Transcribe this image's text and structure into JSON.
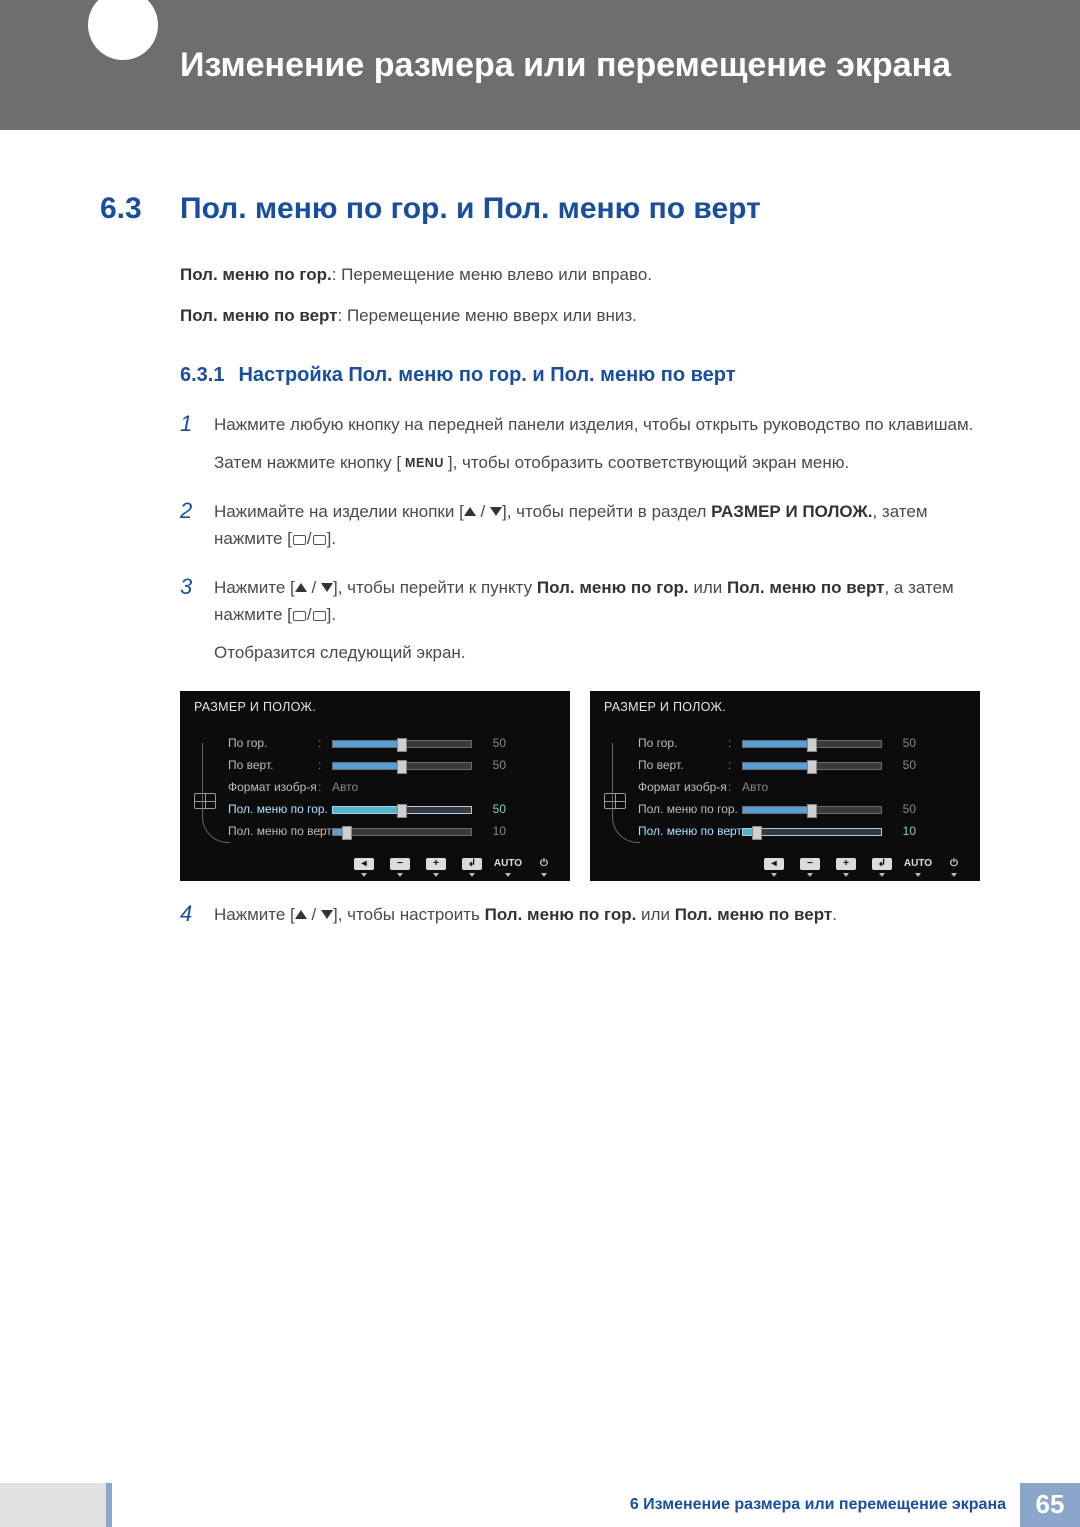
{
  "header": {
    "title": "Изменение размера или перемещение экрана"
  },
  "section": {
    "number": "6.3",
    "title": "Пол. меню по гор. и Пол. меню по верт"
  },
  "definitions": {
    "d1_bold": "Пол. меню по гор.",
    "d1_text": ": Перемещение меню влево или вправо.",
    "d2_bold": "Пол. меню по верт",
    "d2_text": ": Перемещение меню вверх или вниз."
  },
  "subsection": {
    "number": "6.3.1",
    "title": "Настройка Пол. меню по гор. и Пол. меню по верт"
  },
  "steps": {
    "s1": {
      "num": "1",
      "p1": "Нажмите любую кнопку на передней панели изделия, чтобы открыть руководство по клавишам.",
      "p2a": "Затем нажмите кнопку [",
      "menu": "MENU",
      "p2b": "], чтобы отобразить соответствующий экран меню."
    },
    "s2": {
      "num": "2",
      "p_a": "Нажимайте на изделии кнопки [",
      "p_b": "], чтобы перейти в раздел ",
      "bold": "РАЗМЕР И ПОЛОЖ.",
      "p_c": ", затем нажмите [",
      "p_d": "]."
    },
    "s3": {
      "num": "3",
      "p_a": "Нажмите [",
      "p_b": "], чтобы перейти к пункту ",
      "bold1": "Пол. меню по гор.",
      "mid": " или ",
      "bold2": "Пол. меню по верт",
      "p_c": ", а затем нажмите [",
      "p_d": "].",
      "p2": "Отобразится следующий экран."
    },
    "s4": {
      "num": "4",
      "p_a": "Нажмите [",
      "p_b": "], чтобы настроить ",
      "bold1": "Пол. меню по гор.",
      "mid": " или ",
      "bold2": "Пол. меню по верт",
      "p_c": "."
    }
  },
  "osd": {
    "title": "РАЗМЕР И ПОЛОЖ.",
    "rows": {
      "r1": {
        "label": "По гор.",
        "value": "50",
        "fill": 50
      },
      "r2": {
        "label": "По верт.",
        "value": "50",
        "fill": 50
      },
      "r3": {
        "label": "Формат изобр-я",
        "text": "Авто"
      },
      "r4": {
        "label": "Пол. меню по гор.",
        "value": "50",
        "fill": 50
      },
      "r5": {
        "label": "Пол. меню по верт",
        "value": "10",
        "fill": 10
      }
    },
    "btns": {
      "auto": "AUTO"
    }
  },
  "footer": {
    "chapter_num": "6",
    "chapter_title": "Изменение размера или перемещение экрана",
    "page": "65"
  }
}
